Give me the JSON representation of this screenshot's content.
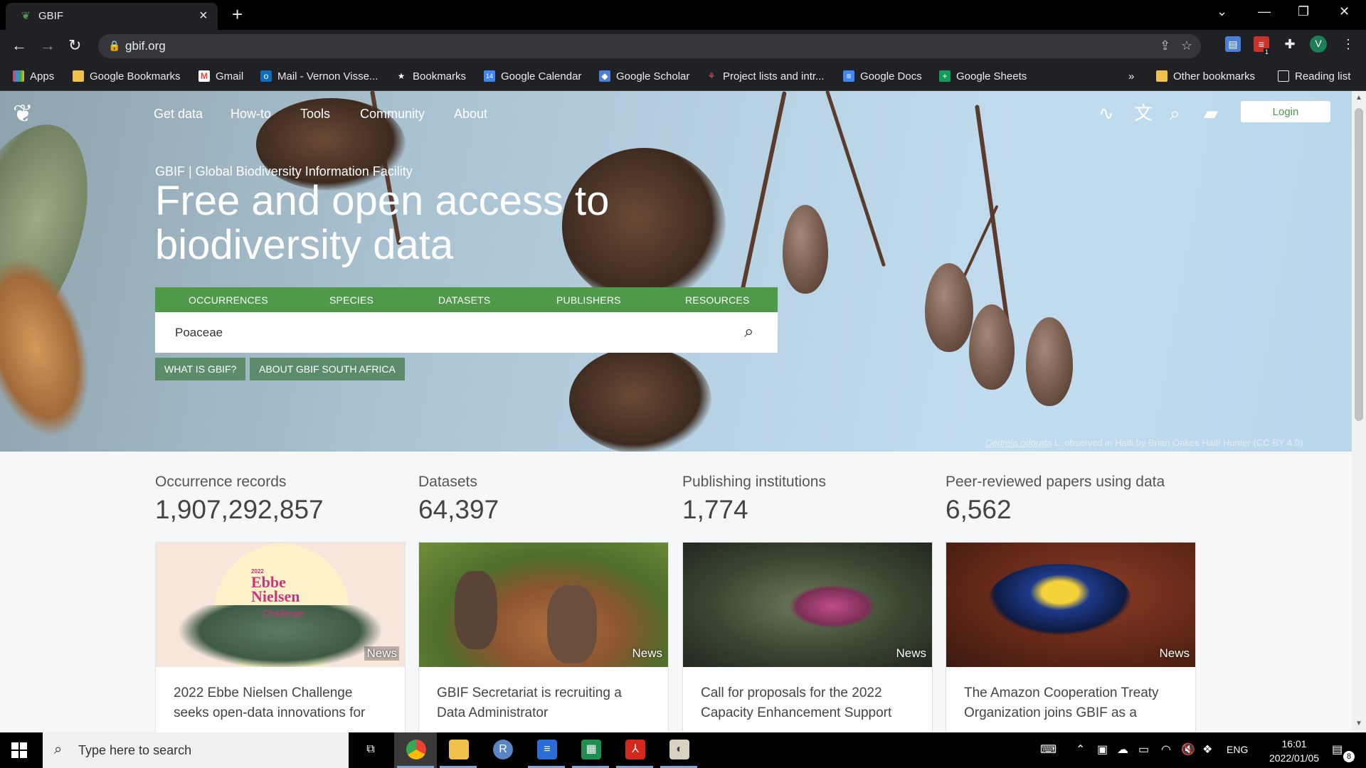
{
  "browser": {
    "tab_title": "GBIF",
    "url": "gbif.org",
    "bookmarks": [
      {
        "label": "Apps"
      },
      {
        "label": "Google Bookmarks"
      },
      {
        "label": "Gmail"
      },
      {
        "label": "Mail - Vernon Visse..."
      },
      {
        "label": "Bookmarks"
      },
      {
        "label": "Google Calendar"
      },
      {
        "label": "Google Scholar"
      },
      {
        "label": "Project lists and intr..."
      },
      {
        "label": "Google Docs"
      },
      {
        "label": "Google Sheets"
      }
    ],
    "overflow": "»",
    "other_bookmarks": "Other bookmarks",
    "reading_list": "Reading list",
    "profile_initial": "V",
    "ext_badge": "1"
  },
  "site": {
    "nav": [
      "Get data",
      "How-to",
      "Tools",
      "Community",
      "About"
    ],
    "login": "Login",
    "kicker": "GBIF | Global Biodiversity Information Facility",
    "headline": "Free and open access to biodiversity data",
    "search_tabs": [
      "OCCURRENCES",
      "SPECIES",
      "DATASETS",
      "PUBLISHERS",
      "RESOURCES"
    ],
    "search_value": "Poaceae",
    "buttons": [
      "WHAT IS GBIF?",
      "ABOUT GBIF SOUTH AFRICA"
    ],
    "credit_species": "Cedrela odorata",
    "credit_rest": " L. observed in Haiti by Brian Oakes Haiti Hunter (CC BY 4.0)",
    "stats": [
      {
        "label": "Occurrence records",
        "value": "1,907,292,857"
      },
      {
        "label": "Datasets",
        "value": "64,397"
      },
      {
        "label": "Publishing institutions",
        "value": "1,774"
      },
      {
        "label": "Peer-reviewed papers using data",
        "value": "6,562"
      }
    ],
    "cards": [
      {
        "tag": "News",
        "title": "2022 Ebbe Nielsen Challenge seeks open-data innovations for",
        "img_year": "2022",
        "img_title1": "Ebbe",
        "img_title2": "Nielsen",
        "img_sub": "Challenge"
      },
      {
        "tag": "News",
        "title": "GBIF Secretariat is recruiting a Data Administrator"
      },
      {
        "tag": "News",
        "title": "Call for proposals for the 2022 Capacity Enhancement Support"
      },
      {
        "tag": "News",
        "title": "The Amazon Cooperation Treaty Organization joins GBIF as a"
      }
    ]
  },
  "taskbar": {
    "search_placeholder": "Type here to search",
    "lang": "ENG",
    "time": "16:01",
    "date": "2022/01/05",
    "notif_count": "8"
  }
}
